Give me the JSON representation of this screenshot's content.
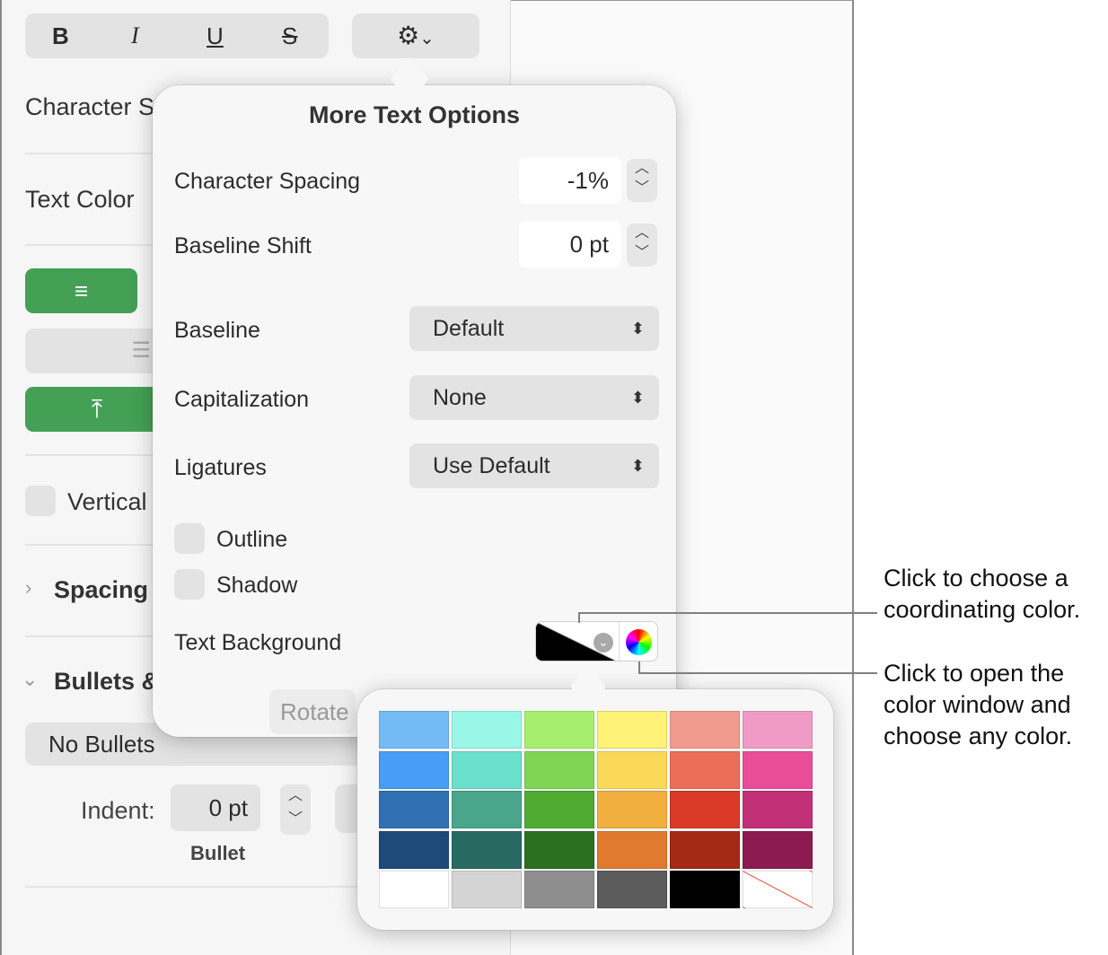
{
  "toolbar": {
    "bold": "B",
    "italic": "I",
    "underline": "U",
    "strike": "S",
    "gear_icon": "gear-icon",
    "chevron": "⌄"
  },
  "sidebar": {
    "character_styles": "Character Styles",
    "text_color": "Text Color",
    "vertical_text": "Vertical Text",
    "spacing": "Spacing",
    "bullets": "Bullets & Lists",
    "no_bullets": "No Bullets",
    "indent_label": "Indent:",
    "indent_value": "0 pt",
    "bullet_caption": "Bullet",
    "rotate": "Rotate"
  },
  "popover": {
    "title": "More Text Options",
    "character_spacing": {
      "label": "Character Spacing",
      "value": "-1%"
    },
    "baseline_shift": {
      "label": "Baseline Shift",
      "value": "0 pt"
    },
    "baseline": {
      "label": "Baseline",
      "value": "Default"
    },
    "capitalization": {
      "label": "Capitalization",
      "value": "None"
    },
    "ligatures": {
      "label": "Ligatures",
      "value": "Use Default"
    },
    "outline": {
      "label": "Outline",
      "checked": false
    },
    "shadow": {
      "label": "Shadow",
      "checked": false
    },
    "text_background": {
      "label": "Text Background"
    }
  },
  "palette": {
    "rows": [
      [
        "#74bbf5",
        "#99f7e7",
        "#a6ef6e",
        "#fdf176",
        "#f09b8d",
        "#f09bc6"
      ],
      [
        "#479ef4",
        "#6be0cc",
        "#80d653",
        "#fad958",
        "#eb6d58",
        "#e94d9a"
      ],
      [
        "#3170b2",
        "#4aa68b",
        "#4faa32",
        "#f0af3f",
        "#da3a27",
        "#c23077"
      ],
      [
        "#1e4a7a",
        "#286a62",
        "#2c6f21",
        "#e07a2e",
        "#a62916",
        "#8b1b50"
      ],
      [
        "#ffffff",
        "#d4d4d4",
        "#8e8e8e",
        "#5c5c5c",
        "#000000",
        "none"
      ]
    ]
  },
  "callouts": {
    "coordinating": "Click to choose a coordinating color.",
    "color_window": "Click to open the color window and choose any color."
  }
}
